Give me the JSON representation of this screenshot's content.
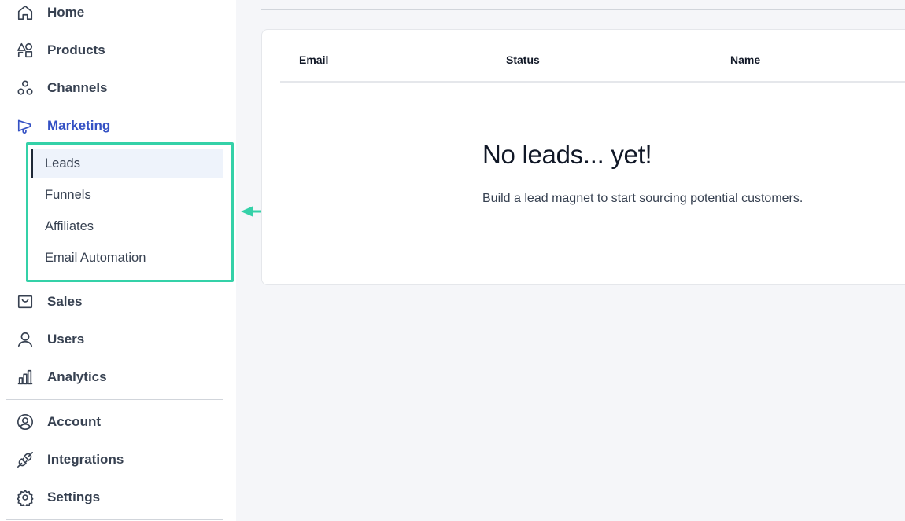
{
  "sidebar": {
    "items": [
      {
        "label": "Home",
        "icon": "home-icon"
      },
      {
        "label": "Products",
        "icon": "products-icon"
      },
      {
        "label": "Channels",
        "icon": "channels-icon"
      },
      {
        "label": "Marketing",
        "icon": "megaphone-icon"
      },
      {
        "label": "Sales",
        "icon": "shopping-bag-icon"
      },
      {
        "label": "Users",
        "icon": "user-icon"
      },
      {
        "label": "Analytics",
        "icon": "bar-chart-icon"
      },
      {
        "label": "Account",
        "icon": "account-circle-icon"
      },
      {
        "label": "Integrations",
        "icon": "plug-icon"
      },
      {
        "label": "Settings",
        "icon": "gear-icon"
      }
    ],
    "active_item": "Marketing",
    "marketing_submenu": [
      {
        "label": "Leads"
      },
      {
        "label": "Funnels"
      },
      {
        "label": "Affiliates"
      },
      {
        "label": "Email Automation"
      }
    ],
    "active_submenu": "Leads"
  },
  "table": {
    "columns": [
      "Email",
      "Status",
      "Name"
    ]
  },
  "empty_state": {
    "title": "No leads... yet!",
    "message": "Build a lead magnet to start sourcing potential customers."
  },
  "colors": {
    "accent": "#3451c4",
    "highlight": "#34d1a8",
    "active_bg": "#eef3fb"
  }
}
